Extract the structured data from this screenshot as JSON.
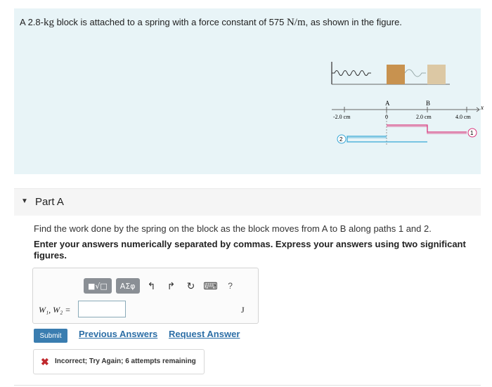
{
  "problem": {
    "text_before": "A 2.8-",
    "mass_unit": "kg",
    "text_middle": " block is attached to a spring with a force constant of 575 ",
    "k_unit": "N/m",
    "text_after": ", as shown in the figure."
  },
  "figure": {
    "label_a": "A",
    "label_b": "B",
    "tick_neg2": "-2.0 cm",
    "tick_0": "0",
    "tick_2": "2.0 cm",
    "tick_4": "4.0 cm",
    "axis_label": "x",
    "path1_marker": "1",
    "path2_marker": "2",
    "colors": {
      "path1": "#d9347a",
      "path2": "#36a7d6",
      "block": "#c8924f",
      "block_light": "#dcc8a4"
    }
  },
  "part": {
    "title": "Part A"
  },
  "question": "Find the work done by the spring on the block as the block moves from A to B along paths 1 and 2.",
  "instructions": "Enter your answers numerically separated by commas. Express your answers using two significant figures.",
  "toolbar": {
    "templates_label": "■√□",
    "greek_label": "ΑΣφ",
    "undo_icon": "↰",
    "redo_icon": "↱",
    "reset_icon": "↻",
    "keyboard_icon": "⌨",
    "help_label": "?"
  },
  "answer": {
    "label": "W₁, W₂ =",
    "value": "",
    "units": "J"
  },
  "actions": {
    "submit": "Submit",
    "previous_answers": "Previous Answers",
    "request_answer": "Request Answer"
  },
  "feedback": {
    "icon": "✖",
    "message": "Incorrect; Try Again; 6 attempts remaining"
  }
}
